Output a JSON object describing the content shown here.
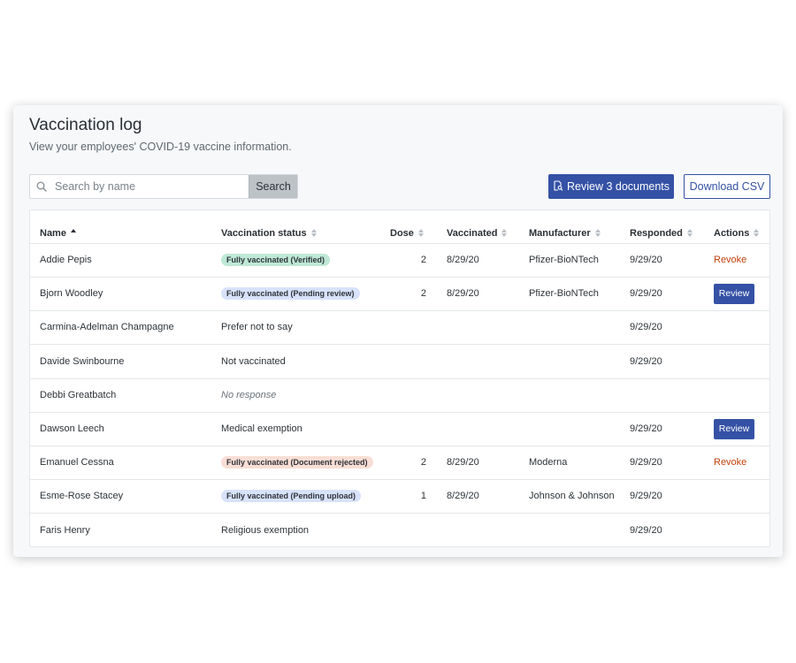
{
  "page": {
    "title": "Vaccination log",
    "subtitle": "View your employees' COVID-19 vaccine information."
  },
  "search": {
    "placeholder": "Search by name",
    "value": "",
    "button_label": "Search"
  },
  "actions": {
    "review_documents_label": "Review 3 documents",
    "download_label": "Download CSV"
  },
  "colors": {
    "primary": "#3451a5",
    "revoke": "#c2410c",
    "badge_verified": "#bfe9d6",
    "badge_pending": "#d8e2fa",
    "badge_rejected": "#f8ded5"
  },
  "table": {
    "columns": [
      {
        "label": "Name",
        "sort": "ascending"
      },
      {
        "label": "Vaccination status",
        "sort": "none"
      },
      {
        "label": "Dose",
        "sort": "none"
      },
      {
        "label": "Vaccinated",
        "sort": "none"
      },
      {
        "label": "Manufacturer",
        "sort": "none"
      },
      {
        "label": "Responded",
        "sort": "none"
      },
      {
        "label": "Actions",
        "sort": "none"
      }
    ],
    "rows": [
      {
        "name": "Addie Pepis",
        "status": "Fully vaccinated (Verified)",
        "status_type": "verified",
        "dose": "2",
        "vaccinated": "8/29/20",
        "manufacturer": "Pfizer-BioNTech",
        "responded": "9/29/20",
        "action": "Revoke"
      },
      {
        "name": "Bjorn Woodley",
        "status": "Fully vaccinated (Pending review)",
        "status_type": "pending",
        "dose": "2",
        "vaccinated": "8/29/20",
        "manufacturer": "Pfizer-BioNTech",
        "responded": "9/29/20",
        "action": "Review"
      },
      {
        "name": "Carmina-Adelman Champagne",
        "status": "Prefer not to say",
        "status_type": "text",
        "dose": "",
        "vaccinated": "",
        "manufacturer": "",
        "responded": "9/29/20",
        "action": ""
      },
      {
        "name": "Davide Swinbourne",
        "status": "Not vaccinated",
        "status_type": "text",
        "dose": "",
        "vaccinated": "",
        "manufacturer": "",
        "responded": "9/29/20",
        "action": ""
      },
      {
        "name": "Debbi Greatbatch",
        "status": "No response",
        "status_type": "italic",
        "dose": "",
        "vaccinated": "",
        "manufacturer": "",
        "responded": "",
        "action": ""
      },
      {
        "name": "Dawson Leech",
        "status": "Medical exemption",
        "status_type": "text",
        "dose": "",
        "vaccinated": "",
        "manufacturer": "",
        "responded": "9/29/20",
        "action": "Review"
      },
      {
        "name": "Emanuel Cessna",
        "status": "Fully vaccinated (Document rejected)",
        "status_type": "rejected",
        "dose": "2",
        "vaccinated": "8/29/20",
        "manufacturer": "Moderna",
        "responded": "9/29/20",
        "action": "Revoke"
      },
      {
        "name": "Esme-Rose Stacey",
        "status": "Fully vaccinated (Pending upload)",
        "status_type": "pending",
        "dose": "1",
        "vaccinated": "8/29/20",
        "manufacturer": "Johnson & Johnson",
        "responded": "9/29/20",
        "action": ""
      },
      {
        "name": "Faris Henry",
        "status": "Religious exemption",
        "status_type": "text",
        "dose": "",
        "vaccinated": "",
        "manufacturer": "",
        "responded": "9/29/20",
        "action": ""
      }
    ]
  }
}
